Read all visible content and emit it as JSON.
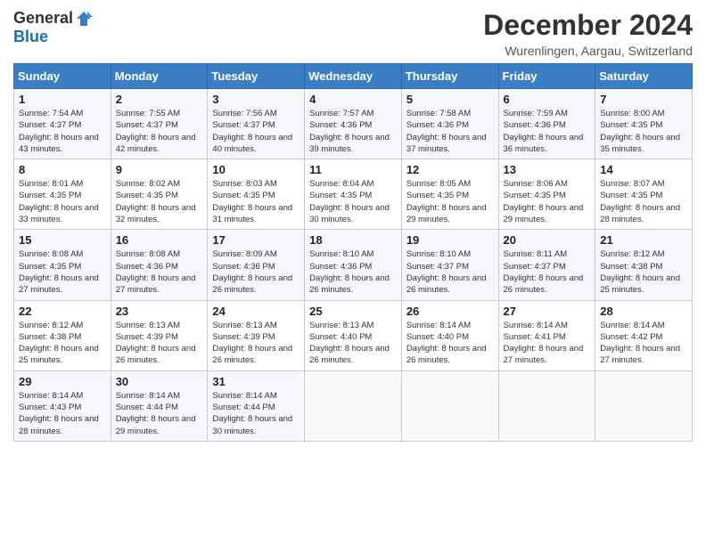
{
  "logo": {
    "general": "General",
    "blue": "Blue"
  },
  "title": "December 2024",
  "location": "Wurenlingen, Aargau, Switzerland",
  "days_of_week": [
    "Sunday",
    "Monday",
    "Tuesday",
    "Wednesday",
    "Thursday",
    "Friday",
    "Saturday"
  ],
  "weeks": [
    [
      {
        "day": "1",
        "sunrise": "7:54 AM",
        "sunset": "4:37 PM",
        "daylight": "8 hours and 43 minutes."
      },
      {
        "day": "2",
        "sunrise": "7:55 AM",
        "sunset": "4:37 PM",
        "daylight": "8 hours and 42 minutes."
      },
      {
        "day": "3",
        "sunrise": "7:56 AM",
        "sunset": "4:37 PM",
        "daylight": "8 hours and 40 minutes."
      },
      {
        "day": "4",
        "sunrise": "7:57 AM",
        "sunset": "4:36 PM",
        "daylight": "8 hours and 39 minutes."
      },
      {
        "day": "5",
        "sunrise": "7:58 AM",
        "sunset": "4:36 PM",
        "daylight": "8 hours and 37 minutes."
      },
      {
        "day": "6",
        "sunrise": "7:59 AM",
        "sunset": "4:36 PM",
        "daylight": "8 hours and 36 minutes."
      },
      {
        "day": "7",
        "sunrise": "8:00 AM",
        "sunset": "4:35 PM",
        "daylight": "8 hours and 35 minutes."
      }
    ],
    [
      {
        "day": "8",
        "sunrise": "8:01 AM",
        "sunset": "4:35 PM",
        "daylight": "8 hours and 33 minutes."
      },
      {
        "day": "9",
        "sunrise": "8:02 AM",
        "sunset": "4:35 PM",
        "daylight": "8 hours and 32 minutes."
      },
      {
        "day": "10",
        "sunrise": "8:03 AM",
        "sunset": "4:35 PM",
        "daylight": "8 hours and 31 minutes."
      },
      {
        "day": "11",
        "sunrise": "8:04 AM",
        "sunset": "4:35 PM",
        "daylight": "8 hours and 30 minutes."
      },
      {
        "day": "12",
        "sunrise": "8:05 AM",
        "sunset": "4:35 PM",
        "daylight": "8 hours and 29 minutes."
      },
      {
        "day": "13",
        "sunrise": "8:06 AM",
        "sunset": "4:35 PM",
        "daylight": "8 hours and 29 minutes."
      },
      {
        "day": "14",
        "sunrise": "8:07 AM",
        "sunset": "4:35 PM",
        "daylight": "8 hours and 28 minutes."
      }
    ],
    [
      {
        "day": "15",
        "sunrise": "8:08 AM",
        "sunset": "4:35 PM",
        "daylight": "8 hours and 27 minutes."
      },
      {
        "day": "16",
        "sunrise": "8:08 AM",
        "sunset": "4:36 PM",
        "daylight": "8 hours and 27 minutes."
      },
      {
        "day": "17",
        "sunrise": "8:09 AM",
        "sunset": "4:36 PM",
        "daylight": "8 hours and 26 minutes."
      },
      {
        "day": "18",
        "sunrise": "8:10 AM",
        "sunset": "4:36 PM",
        "daylight": "8 hours and 26 minutes."
      },
      {
        "day": "19",
        "sunrise": "8:10 AM",
        "sunset": "4:37 PM",
        "daylight": "8 hours and 26 minutes."
      },
      {
        "day": "20",
        "sunrise": "8:11 AM",
        "sunset": "4:37 PM",
        "daylight": "8 hours and 26 minutes."
      },
      {
        "day": "21",
        "sunrise": "8:12 AM",
        "sunset": "4:38 PM",
        "daylight": "8 hours and 25 minutes."
      }
    ],
    [
      {
        "day": "22",
        "sunrise": "8:12 AM",
        "sunset": "4:38 PM",
        "daylight": "8 hours and 25 minutes."
      },
      {
        "day": "23",
        "sunrise": "8:13 AM",
        "sunset": "4:39 PM",
        "daylight": "8 hours and 26 minutes."
      },
      {
        "day": "24",
        "sunrise": "8:13 AM",
        "sunset": "4:39 PM",
        "daylight": "8 hours and 26 minutes."
      },
      {
        "day": "25",
        "sunrise": "8:13 AM",
        "sunset": "4:40 PM",
        "daylight": "8 hours and 26 minutes."
      },
      {
        "day": "26",
        "sunrise": "8:14 AM",
        "sunset": "4:40 PM",
        "daylight": "8 hours and 26 minutes."
      },
      {
        "day": "27",
        "sunrise": "8:14 AM",
        "sunset": "4:41 PM",
        "daylight": "8 hours and 27 minutes."
      },
      {
        "day": "28",
        "sunrise": "8:14 AM",
        "sunset": "4:42 PM",
        "daylight": "8 hours and 27 minutes."
      }
    ],
    [
      {
        "day": "29",
        "sunrise": "8:14 AM",
        "sunset": "4:43 PM",
        "daylight": "8 hours and 28 minutes."
      },
      {
        "day": "30",
        "sunrise": "8:14 AM",
        "sunset": "4:44 PM",
        "daylight": "8 hours and 29 minutes."
      },
      {
        "day": "31",
        "sunrise": "8:14 AM",
        "sunset": "4:44 PM",
        "daylight": "8 hours and 30 minutes."
      },
      null,
      null,
      null,
      null
    ]
  ],
  "labels": {
    "sunrise": "Sunrise:",
    "sunset": "Sunset:",
    "daylight": "Daylight:"
  }
}
